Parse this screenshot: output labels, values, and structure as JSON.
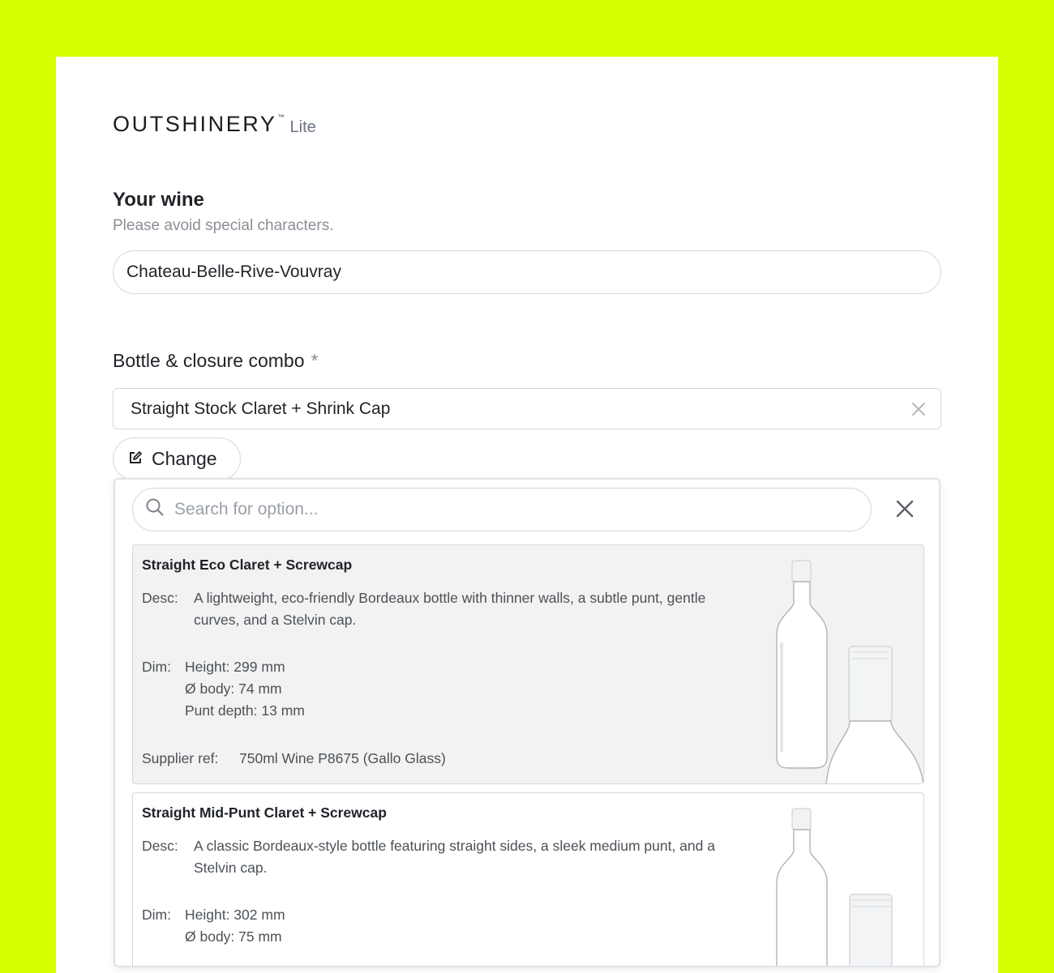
{
  "brand": {
    "name": "OUTSHINERY",
    "tm": "™",
    "edition": "Lite"
  },
  "wine": {
    "title": "Your wine",
    "hint": "Please avoid special characters.",
    "value": "Chateau-Belle-Rive-Vouvray"
  },
  "combo": {
    "label": "Bottle & closure combo",
    "required_mark": "*",
    "selected": "Straight Stock Claret + Shrink Cap",
    "clear_icon": "close-icon",
    "change_label": "Change",
    "change_icon": "edit-icon"
  },
  "dropdown": {
    "search_placeholder": "Search for option...",
    "search_icon": "search-icon",
    "close_icon": "close-icon",
    "options": [
      {
        "title": "Straight Eco Claret + Screwcap",
        "desc_label": "Desc:",
        "desc": "A lightweight, eco-friendly Bordeaux bottle with thinner walls, a subtle punt, gentle curves, and a Stelvin cap.",
        "dim_label": "Dim:",
        "dims": [
          "Height: 299 mm",
          "Ø body: 74 mm",
          "Punt depth: 13 mm"
        ],
        "supplier_label": "Supplier ref:",
        "supplier": "750ml Wine P8675 (Gallo Glass)",
        "image": "bottle-image"
      },
      {
        "title": "Straight Mid-Punt Claret + Screwcap",
        "desc_label": "Desc:",
        "desc": "A classic Bordeaux-style bottle featuring straight sides, a sleek medium punt, and a Stelvin cap.",
        "dim_label": "Dim:",
        "dims": [
          "Height: 302 mm",
          "Ø body: 75 mm"
        ],
        "image": "bottle-image"
      }
    ]
  },
  "colors": {
    "page_background": "#d8ff00",
    "card": "#ffffff",
    "highlight_option": "#f2f2f2"
  }
}
